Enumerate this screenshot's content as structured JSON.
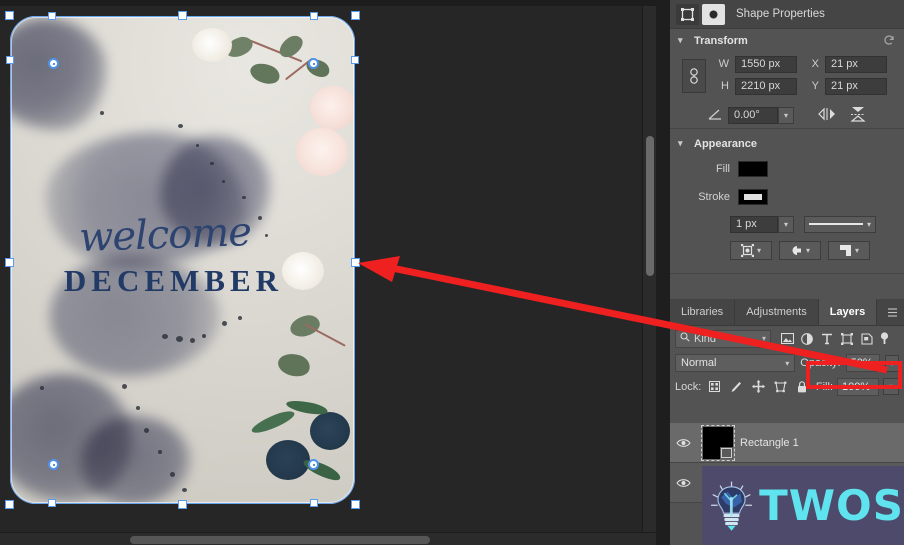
{
  "panel": {
    "title": "Shape Properties",
    "icons": {
      "shape_tool": "shape-transform-icon",
      "mask": "mask-icon"
    }
  },
  "transform": {
    "section_label": "Transform",
    "reset_icon": "reset-icon",
    "link_icon": "link-chain-icon",
    "w_label": "W",
    "w_value": "1550 px",
    "h_label": "H",
    "h_value": "2210 px",
    "x_label": "X",
    "x_value": "21 px",
    "y_label": "Y",
    "y_value": "21 px",
    "angle_value": "0.00°",
    "angle_icon": "angle-icon",
    "flip_horizontal_icon": "flip-horizontal-icon",
    "flip_vertical_icon": "flip-vertical-icon"
  },
  "appearance": {
    "section_label": "Appearance",
    "fill_label": "Fill",
    "fill_color": "#000000",
    "stroke_label": "Stroke",
    "stroke_color": "#000000",
    "stroke_width": "1 px",
    "stroke_style": "solid-line-preview",
    "align_icon": "stroke-align-icon",
    "caps_icon": "stroke-caps-icon",
    "corners_icon": "stroke-corners-icon"
  },
  "layers_dock": {
    "tabs": [
      {
        "label": "Libraries",
        "active": false
      },
      {
        "label": "Adjustments",
        "active": false
      },
      {
        "label": "Layers",
        "active": true
      }
    ],
    "menu_icon": "panel-menu-icon",
    "filter": {
      "search_icon": "search-icon",
      "kind_value": "Kind",
      "filter_icons": [
        "pixel-layer-filter-icon",
        "adjustment-layer-filter-icon",
        "type-layer-filter-icon",
        "shape-layer-filter-icon",
        "smart-object-filter-icon",
        "filter-toggle-icon"
      ]
    },
    "blend_mode": "Normal",
    "opacity_label": "Opacity:",
    "opacity_value": "50%",
    "lock_label": "Lock:",
    "lock_icons": [
      "lock-transparent-pixels-icon",
      "lock-image-pixels-icon",
      "lock-position-icon",
      "lock-artboard-nesting-icon",
      "lock-all-icon"
    ],
    "fill_label": "Fill:",
    "fill_value": "100%",
    "layers": [
      {
        "name": "Rectangle 1",
        "visible": true,
        "selected": true,
        "eye_icon": "eye-icon",
        "thumb": "black-shape-thumbnail"
      },
      {
        "name": "",
        "visible": true,
        "selected": false,
        "eye_icon": "eye-icon",
        "thumb": "photo-thumbnail"
      }
    ]
  },
  "canvas": {
    "artwork": {
      "script_text": "welcome",
      "title_text": "DECEMBER",
      "script_color": "#2d4370",
      "title_color": "#213a66"
    },
    "selection": {
      "handle_fill": "#ffffff",
      "handle_border": "#5b9bea",
      "radius_handle_icon": "corner-radius-handle-icon"
    },
    "scrollbars": {
      "horizontal": "horizontal-scrollbar",
      "vertical": "vertical-scrollbar"
    }
  },
  "annotations": {
    "highlight_color": "#ee2020",
    "arrow_icon": "red-arrow-annotation",
    "box_icon": "red-highlight-box"
  },
  "watermark": {
    "text": "TWOS",
    "logo_icon": "lightbulb-logo-icon",
    "text_color": "#5fe3ee",
    "bg_color": "#4e4a6b"
  }
}
